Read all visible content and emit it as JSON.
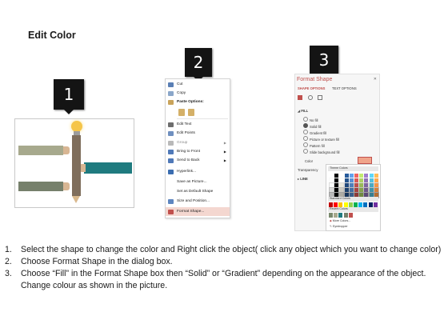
{
  "title": "Edit Color",
  "badges": [
    "1",
    "2",
    "3"
  ],
  "colors": {
    "bar_olive": "#a7a98d",
    "bar_green": "#76806b",
    "bar_teal": "#1f7b7f",
    "pencil": "#7f6e5c",
    "bulb": "#f5c54a",
    "accent": "#c0504d",
    "highlight": "#f4d7d0"
  },
  "context_menu": {
    "items": [
      {
        "label": "Cut",
        "icon": "scissors-icon"
      },
      {
        "label": "Copy",
        "icon": "copy-icon"
      },
      {
        "label": "Paste Options:",
        "icon": "paste-icon"
      },
      {
        "label": "",
        "icon": "paste-options-icon"
      },
      {
        "label": "Edit Text",
        "icon": "edit-text-icon"
      },
      {
        "label": "Edit Points",
        "icon": "edit-points-icon"
      },
      {
        "label": "Group",
        "icon": "group-icon"
      },
      {
        "label": "Bring to Front",
        "icon": "bring-front-icon"
      },
      {
        "label": "Send to Back",
        "icon": "send-back-icon"
      },
      {
        "label": "Hyperlink...",
        "icon": "link-icon"
      },
      {
        "label": "Save as Picture...",
        "icon": ""
      },
      {
        "label": "Set as Default Shape",
        "icon": ""
      },
      {
        "label": "Size and Position...",
        "icon": "size-icon"
      },
      {
        "label": "Format Shape...",
        "icon": "format-shape-icon"
      }
    ]
  },
  "format_panel": {
    "title": "Format Shape",
    "tab_shape": "SHAPE OPTIONS",
    "tab_text": "TEXT OPTIONS",
    "fill_header": "FILL",
    "fill_options": [
      "No fill",
      "Solid fill",
      "Gradient fill",
      "Picture or texture fill",
      "Pattern fill",
      "Slide background fill"
    ],
    "selected_fill": "Solid fill",
    "color_label": "Color",
    "transparency_label": "Transparency",
    "line_header": "LINE",
    "theme_colors_label": "Theme Colors",
    "standard_colors_label": "Standard Colors",
    "recent_colors_label": "Recent Colors",
    "more_colors": "More Colors...",
    "eyedropper": "Eyedropper"
  },
  "steps": [
    {
      "num": "1.",
      "text": "Select the shape to change the color and Right click the object( click any object which you want to change color)"
    },
    {
      "num": "2.",
      "text": "Choose Format Shape in the dialog box."
    },
    {
      "num": "3.",
      "text": "Choose “Fill” in the Format Shape box then “Solid” or “Gradient” depending on the appearance of the object. Change colour as shown in the picture."
    }
  ]
}
